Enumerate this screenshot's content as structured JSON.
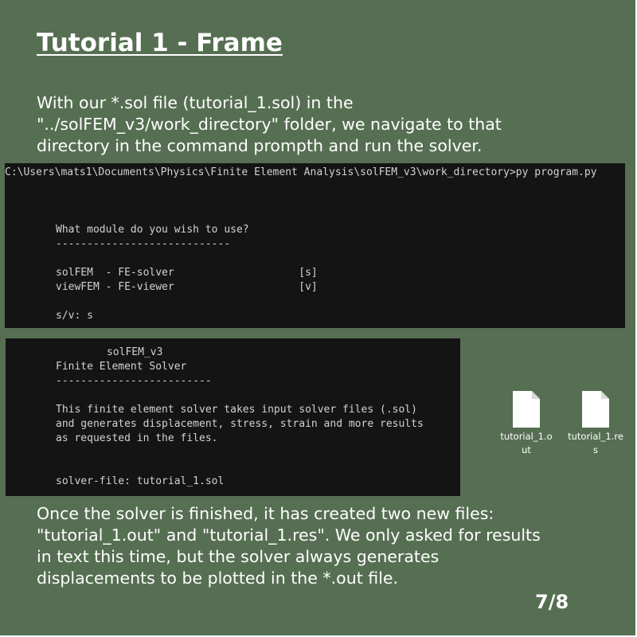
{
  "title": "Tutorial 1 - Frame",
  "intro": {
    "lines": [
      "With our *.sol file (tutorial_1.sol) in the",
      "\"../solFEM_v3/work_directory\" folder, we navigate to that",
      "directory in the command prompth and run the solver."
    ]
  },
  "terminal_top": {
    "command_line": "C:\\Users\\mats1\\Documents\\Physics\\Finite Element Analysis\\solFEM_v3\\work_directory>py program.py",
    "prompt_heading": "What module do you wish to use?",
    "prompt_rule": "----------------------------",
    "option_solfem": "solFEM  - FE-solver                    [s]",
    "option_viewfem": "viewFEM - FE-viewer                    [v]",
    "choice_line": "s/v: s"
  },
  "terminal_bottom": {
    "app_name": "solFEM_v3",
    "app_subtitle": "Finite Element Solver",
    "rule": "-------------------------",
    "description_1": "This finite element solver takes input solver files (.sol)",
    "description_2": "and generates displacement, stress, strain and more results",
    "description_3": "as requested in the files.",
    "input_line": "solver-file: tutorial_1.sol"
  },
  "files": [
    {
      "icon": "file-icon",
      "label_lines": [
        "tutorial_1.o",
        "ut"
      ]
    },
    {
      "icon": "file-icon",
      "label_lines": [
        "tutorial_1.re",
        "s"
      ]
    }
  ],
  "outro": {
    "lines": [
      "Once the solver is finished, it has created two new files:",
      "\"tutorial_1.out\" and \"tutorial_1.res\". We only asked for results",
      "in text this time, but the solver always generates",
      "displacements to be plotted in the *.out file."
    ]
  },
  "page_number": "7/8",
  "colors": {
    "background": "#566f52",
    "terminal_background": "#141414",
    "terminal_text": "#d2d2d2",
    "text": "#ffffff"
  }
}
